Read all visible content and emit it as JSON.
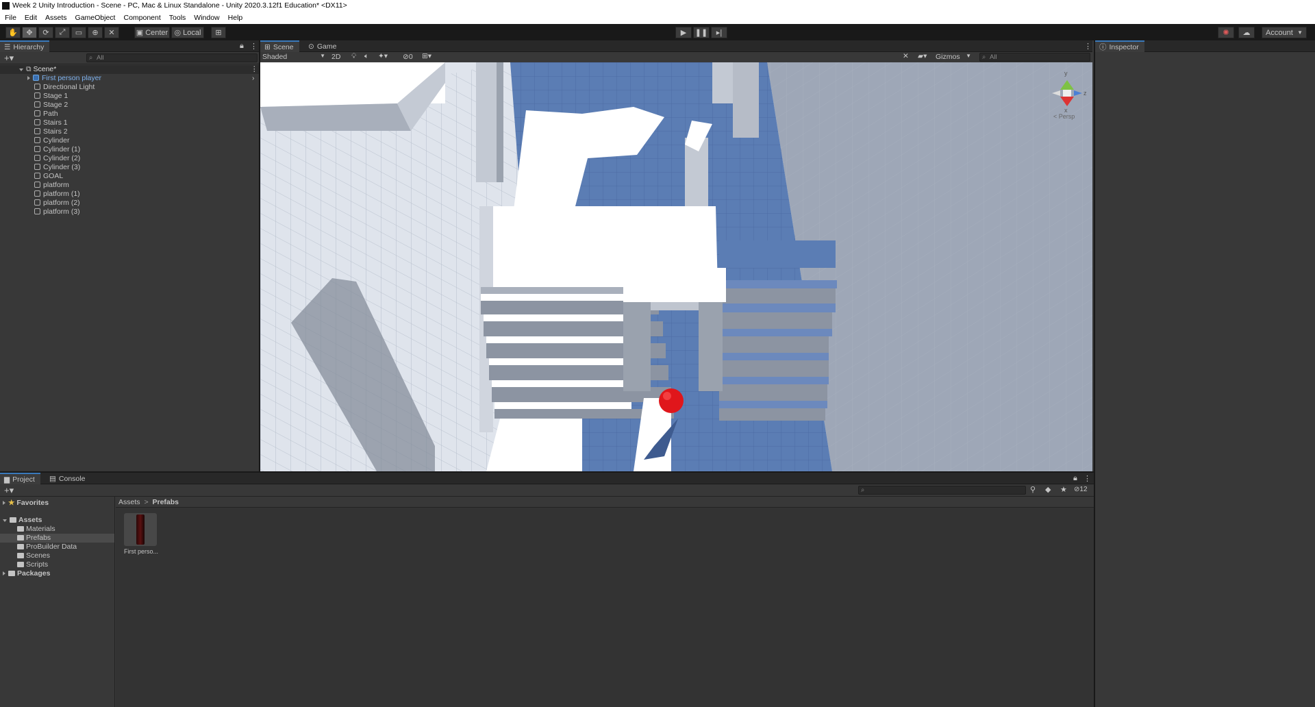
{
  "window": {
    "title": "Week 2 Unity Introduction - Scene - PC, Mac & Linux Standalone - Unity 2020.3.12f1 Education* <DX11>"
  },
  "menu": [
    "File",
    "Edit",
    "Assets",
    "GameObject",
    "Component",
    "Tools",
    "Window",
    "Help"
  ],
  "toolbar": {
    "center_label": "Center",
    "local_label": "Local",
    "account_label": "Account"
  },
  "hierarchy": {
    "tab": "Hierarchy",
    "search_placeholder": "All",
    "scene": "Scene*",
    "items": [
      "First person player",
      "Directional Light",
      "Stage 1",
      "Stage 2",
      "Path",
      "Stairs 1",
      "Stairs 2",
      "Cylinder",
      "Cylinder (1)",
      "Cylinder (2)",
      "Cylinder (3)",
      "GOAL",
      "platform",
      "platform (1)",
      "platform (2)",
      "platform (3)"
    ]
  },
  "scene_view": {
    "tab_scene": "Scene",
    "tab_game": "Game",
    "shading": "Shaded",
    "mode_2d": "2D",
    "hidden_count": "0",
    "gizmos": "Gizmos",
    "search_placeholder": "All",
    "axis_y": "y",
    "axis_z": "z",
    "axis_x": "x",
    "persp": "< Persp"
  },
  "inspector": {
    "tab": "Inspector"
  },
  "project": {
    "tab_project": "Project",
    "tab_console": "Console",
    "favorites": "Favorites",
    "assets": "Assets",
    "asset_folders": [
      "Materials",
      "Prefabs",
      "ProBuilder Data",
      "Scenes",
      "Scripts"
    ],
    "packages": "Packages",
    "breadcrumb_root": "Assets",
    "breadcrumb_sep": ">",
    "breadcrumb_current": "Prefabs",
    "asset_item": "First perso...",
    "hidden_count": "12"
  },
  "colors": {
    "accent": "#3a79bb",
    "floor_blue": "#5b7db4",
    "ball_red": "#e0161b"
  }
}
